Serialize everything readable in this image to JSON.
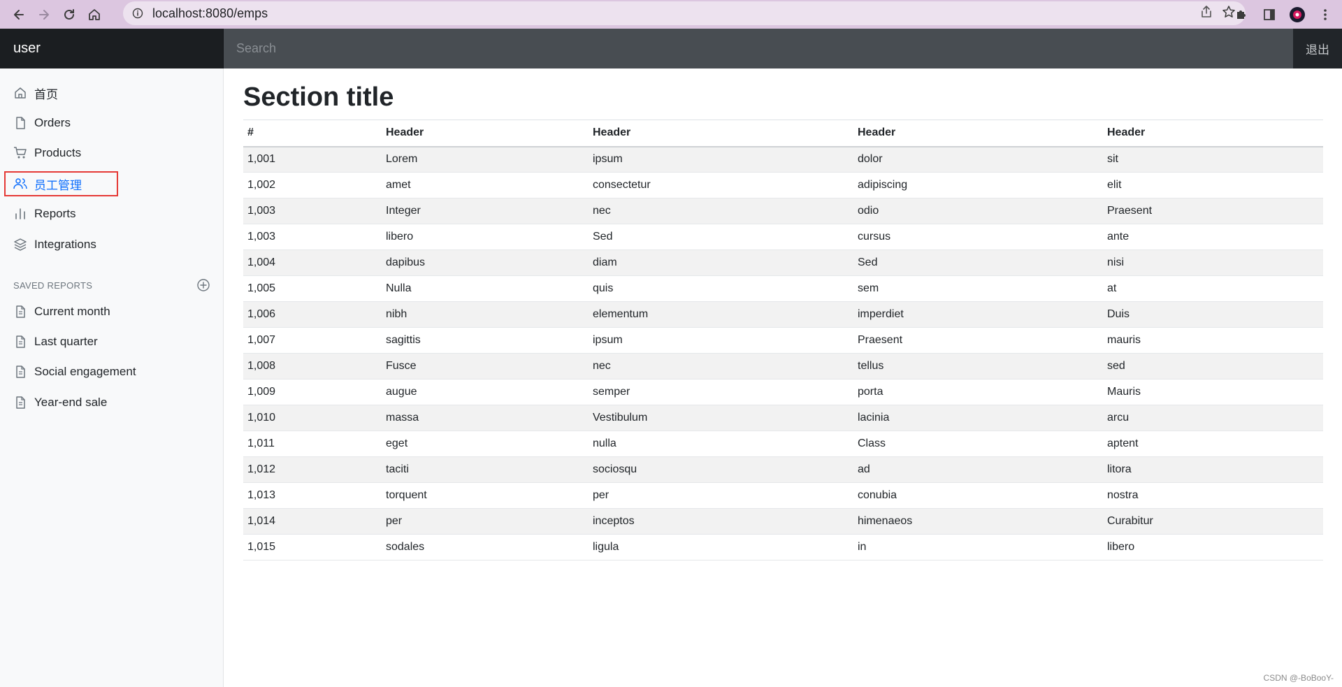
{
  "browser": {
    "url": "localhost:8080/emps"
  },
  "navbar": {
    "brand": "user",
    "search_placeholder": "Search",
    "signout_label": "退出"
  },
  "sidebar": {
    "items": [
      {
        "label": "首页",
        "icon": "home-icon"
      },
      {
        "label": "Orders",
        "icon": "file-icon"
      },
      {
        "label": "Products",
        "icon": "shopping-cart-icon"
      },
      {
        "label": "员工管理",
        "icon": "users-icon",
        "active": true
      },
      {
        "label": "Reports",
        "icon": "bar-chart-icon"
      },
      {
        "label": "Integrations",
        "icon": "layers-icon"
      }
    ],
    "saved_reports_heading": "SAVED REPORTS",
    "saved_reports": [
      {
        "label": "Current month",
        "icon": "file-text-icon"
      },
      {
        "label": "Last quarter",
        "icon": "file-text-icon"
      },
      {
        "label": "Social engagement",
        "icon": "file-text-icon"
      },
      {
        "label": "Year-end sale",
        "icon": "file-text-icon"
      }
    ]
  },
  "main": {
    "section_title": "Section title",
    "table": {
      "headers": [
        "#",
        "Header",
        "Header",
        "Header",
        "Header"
      ],
      "rows": [
        [
          "1,001",
          "Lorem",
          "ipsum",
          "dolor",
          "sit"
        ],
        [
          "1,002",
          "amet",
          "consectetur",
          "adipiscing",
          "elit"
        ],
        [
          "1,003",
          "Integer",
          "nec",
          "odio",
          "Praesent"
        ],
        [
          "1,003",
          "libero",
          "Sed",
          "cursus",
          "ante"
        ],
        [
          "1,004",
          "dapibus",
          "diam",
          "Sed",
          "nisi"
        ],
        [
          "1,005",
          "Nulla",
          "quis",
          "sem",
          "at"
        ],
        [
          "1,006",
          "nibh",
          "elementum",
          "imperdiet",
          "Duis"
        ],
        [
          "1,007",
          "sagittis",
          "ipsum",
          "Praesent",
          "mauris"
        ],
        [
          "1,008",
          "Fusce",
          "nec",
          "tellus",
          "sed"
        ],
        [
          "1,009",
          "augue",
          "semper",
          "porta",
          "Mauris"
        ],
        [
          "1,010",
          "massa",
          "Vestibulum",
          "lacinia",
          "arcu"
        ],
        [
          "1,011",
          "eget",
          "nulla",
          "Class",
          "aptent"
        ],
        [
          "1,012",
          "taciti",
          "sociosqu",
          "ad",
          "litora"
        ],
        [
          "1,013",
          "torquent",
          "per",
          "conubia",
          "nostra"
        ],
        [
          "1,014",
          "per",
          "inceptos",
          "himenaeos",
          "Curabitur"
        ],
        [
          "1,015",
          "sodales",
          "ligula",
          "in",
          "libero"
        ]
      ]
    }
  },
  "watermark": "CSDN @-BoBooY-",
  "colors": {
    "active_link": "#0d6efd",
    "highlight_border": "#e53935",
    "navbar_bg": "#212529",
    "browser_chrome": "#dcc6e0"
  }
}
